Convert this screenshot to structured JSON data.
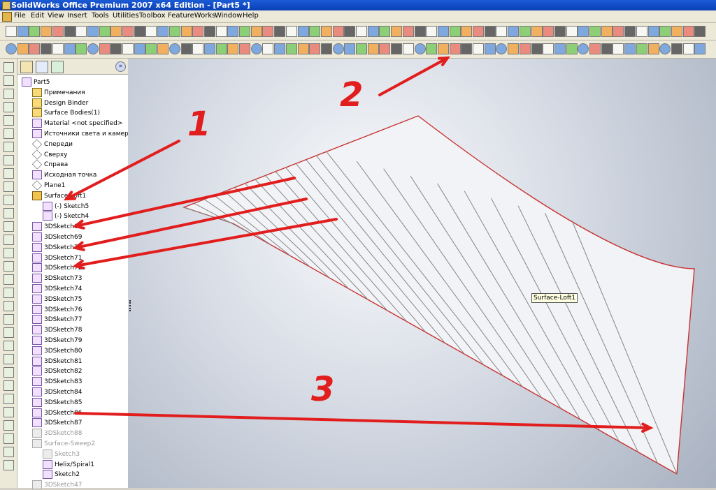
{
  "window": {
    "title": "SolidWorks Office Premium 2007 x64 Edition - [Part5 *]"
  },
  "menu": [
    "File",
    "Edit",
    "View",
    "Insert",
    "Tools",
    "Utilities",
    "Toolbox",
    "FeatureWorks",
    "Window",
    "Help"
  ],
  "tree": {
    "rows": [
      {
        "label": "Part5",
        "icon": "part-icon",
        "indent": 0
      },
      {
        "label": "Примечания",
        "icon": "annotations-icon",
        "indent": 1
      },
      {
        "label": "Design Binder",
        "icon": "binder-icon",
        "indent": 1
      },
      {
        "label": "Surface Bodies(1)",
        "icon": "folder-icon",
        "indent": 1
      },
      {
        "label": "Material <not specified>",
        "icon": "material-icon",
        "indent": 1
      },
      {
        "label": "Источники света и камер",
        "icon": "lights-icon",
        "indent": 1
      },
      {
        "label": "Спереди",
        "icon": "plane-icon",
        "indent": 1
      },
      {
        "label": "Сверху",
        "icon": "plane-icon",
        "indent": 1
      },
      {
        "label": "Справа",
        "icon": "plane-icon",
        "indent": 1
      },
      {
        "label": "Исходная точка",
        "icon": "origin-icon",
        "indent": 1
      },
      {
        "label": "Plane1",
        "icon": "plane-icon",
        "indent": 1
      },
      {
        "label": "Surface-Loft1",
        "icon": "loft-icon",
        "indent": 1
      },
      {
        "label": "(-) Sketch5",
        "icon": "sketch-icon",
        "indent": 2
      },
      {
        "label": "(-) Sketch4",
        "icon": "sketch-icon",
        "indent": 2
      },
      {
        "label": "3DSketch68",
        "icon": "sketch3d-icon",
        "indent": 1
      },
      {
        "label": "3DSketch69",
        "icon": "sketch3d-icon",
        "indent": 1
      },
      {
        "label": "3DSketch70",
        "icon": "sketch3d-icon",
        "indent": 1
      },
      {
        "label": "3DSketch71",
        "icon": "sketch3d-icon",
        "indent": 1
      },
      {
        "label": "3DSketch72",
        "icon": "sketch3d-icon",
        "indent": 1
      },
      {
        "label": "3DSketch73",
        "icon": "sketch3d-icon",
        "indent": 1
      },
      {
        "label": "3DSketch74",
        "icon": "sketch3d-icon",
        "indent": 1
      },
      {
        "label": "3DSketch75",
        "icon": "sketch3d-icon",
        "indent": 1
      },
      {
        "label": "3DSketch76",
        "icon": "sketch3d-icon",
        "indent": 1
      },
      {
        "label": "3DSketch77",
        "icon": "sketch3d-icon",
        "indent": 1
      },
      {
        "label": "3DSketch78",
        "icon": "sketch3d-icon",
        "indent": 1
      },
      {
        "label": "3DSketch79",
        "icon": "sketch3d-icon",
        "indent": 1
      },
      {
        "label": "3DSketch80",
        "icon": "sketch3d-icon",
        "indent": 1
      },
      {
        "label": "3DSketch81",
        "icon": "sketch3d-icon",
        "indent": 1
      },
      {
        "label": "3DSketch82",
        "icon": "sketch3d-icon",
        "indent": 1
      },
      {
        "label": "3DSketch83",
        "icon": "sketch3d-icon",
        "indent": 1
      },
      {
        "label": "3DSketch84",
        "icon": "sketch3d-icon",
        "indent": 1
      },
      {
        "label": "3DSketch85",
        "icon": "sketch3d-icon",
        "indent": 1
      },
      {
        "label": "3DSketch86",
        "icon": "sketch3d-icon",
        "indent": 1
      },
      {
        "label": "3DSketch87",
        "icon": "sketch3d-icon",
        "indent": 1
      },
      {
        "label": "3DSketch88",
        "icon": "sketch3d-icon",
        "indent": 1,
        "gray": true
      },
      {
        "label": "Surface-Sweep2",
        "icon": "sweep-icon",
        "indent": 1,
        "gray": true
      },
      {
        "label": "Sketch3",
        "icon": "sketch-icon",
        "indent": 2,
        "gray": true
      },
      {
        "label": "Helix/Spiral1",
        "icon": "helix-icon",
        "indent": 2
      },
      {
        "label": "Sketch2",
        "icon": "sketch-icon",
        "indent": 2
      },
      {
        "label": "3DSketch47",
        "icon": "sketch3d-icon",
        "indent": 1,
        "gray": true
      }
    ]
  },
  "viewport": {
    "tooltip": "Surface-Loft1",
    "annotations": [
      "1",
      "2",
      "3"
    ]
  },
  "colors": {
    "annotation": "#e21d1d",
    "surface_edge": "#c83232"
  }
}
